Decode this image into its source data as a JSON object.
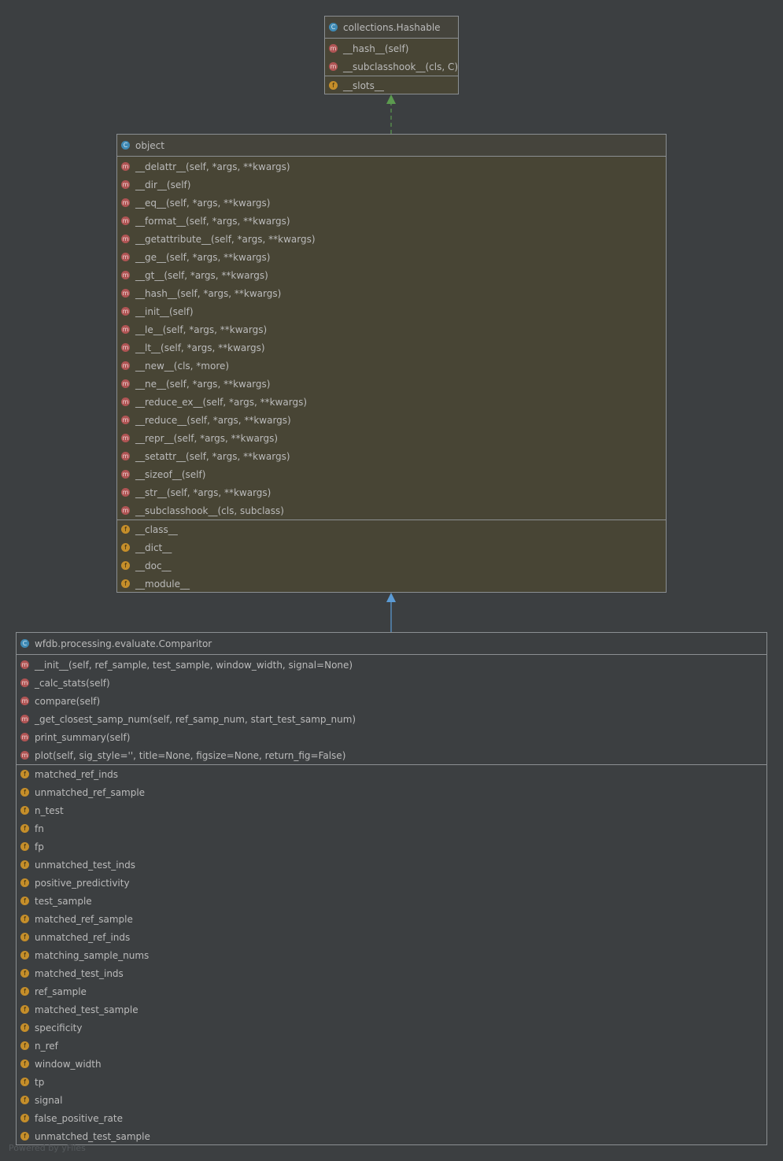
{
  "hashable": {
    "title": "collections.Hashable",
    "methods": [
      "__hash__(self)",
      "__subclasshook__(cls, C)"
    ],
    "fields": [
      "__slots__"
    ]
  },
  "object": {
    "title": "object",
    "methods": [
      "__delattr__(self, *args, **kwargs)",
      "__dir__(self)",
      "__eq__(self, *args, **kwargs)",
      "__format__(self, *args, **kwargs)",
      "__getattribute__(self, *args, **kwargs)",
      "__ge__(self, *args, **kwargs)",
      "__gt__(self, *args, **kwargs)",
      "__hash__(self, *args, **kwargs)",
      "__init__(self)",
      "__le__(self, *args, **kwargs)",
      "__lt__(self, *args, **kwargs)",
      "__new__(cls, *more)",
      "__ne__(self, *args, **kwargs)",
      "__reduce_ex__(self, *args, **kwargs)",
      "__reduce__(self, *args, **kwargs)",
      "__repr__(self, *args, **kwargs)",
      "__setattr__(self, *args, **kwargs)",
      "__sizeof__(self)",
      "__str__(self, *args, **kwargs)",
      "__subclasshook__(cls, subclass)"
    ],
    "fields": [
      "__class__",
      "__dict__",
      "__doc__",
      "__module__"
    ]
  },
  "comparitor": {
    "title": "wfdb.processing.evaluate.Comparitor",
    "methods": [
      "__init__(self, ref_sample, test_sample, window_width, signal=None)",
      "_calc_stats(self)",
      "compare(self)",
      "_get_closest_samp_num(self, ref_samp_num, start_test_samp_num)",
      "print_summary(self)",
      "plot(self, sig_style='', title=None, figsize=None,              return_fig=False)"
    ],
    "fields": [
      "matched_ref_inds",
      "unmatched_ref_sample",
      "n_test",
      "fn",
      "fp",
      "unmatched_test_inds",
      "positive_predictivity",
      "test_sample",
      "matched_ref_sample",
      "unmatched_ref_inds",
      "matching_sample_nums",
      "matched_test_inds",
      "ref_sample",
      "matched_test_sample",
      "specificity",
      "n_ref",
      "window_width",
      "tp",
      "signal",
      "false_positive_rate",
      "unmatched_test_sample"
    ]
  },
  "icons": {
    "class": "C",
    "method": "m",
    "field": "f"
  },
  "colors": {
    "background": "#3c3f41",
    "node_fill": "#484535",
    "class_icon": "#3f8ab5",
    "method_icon": "#b05454",
    "field_icon": "#c58e2a",
    "implements_arrow": "#5c9b4f",
    "extends_arrow": "#5b9bd5"
  },
  "footer": "Powered by yFiles"
}
